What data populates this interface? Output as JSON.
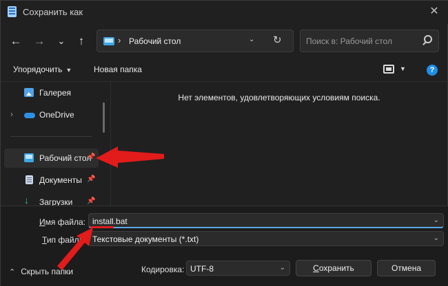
{
  "window": {
    "title": "Сохранить как",
    "close_glyph": "✕"
  },
  "nav": {
    "back": "←",
    "forward": "→",
    "recent": "⌄",
    "up": "↑",
    "address_chevron": "›",
    "address_path": "Рабочий стол",
    "address_dropdown": "⌄",
    "refresh": "↻",
    "search_placeholder": "Поиск в: Рабочий стол"
  },
  "toolbar": {
    "organize_label": "Упорядочить",
    "new_folder_label": "Новая папка",
    "help_label": "?"
  },
  "sidebar": {
    "items": [
      {
        "label": "Галерея",
        "icon": "gallery-icon"
      },
      {
        "label": "OneDrive",
        "icon": "cloud-icon",
        "expander": "›"
      },
      {
        "label": "Рабочий стол",
        "icon": "desktop-folder-icon",
        "pin": "📌",
        "selected": true
      },
      {
        "label": "Документы",
        "icon": "documents-icon",
        "pin": "📌"
      },
      {
        "label": "Загрузки",
        "icon": "downloads-icon",
        "pin": "📌"
      }
    ]
  },
  "main": {
    "empty_message": "Нет элементов, удовлетворяющих условиям поиска."
  },
  "bottom": {
    "filename_label_u": "И",
    "filename_label_rest": "мя файла:",
    "filename_value": "install.bat",
    "filetype_label_u": "Т",
    "filetype_label_rest": "ип файла:",
    "filetype_value": "Текстовые документы (*.txt)",
    "encoding_label": "Кодировка:",
    "encoding_value": "UTF-8",
    "hide_folders_label": "Скрыть папки",
    "save_label_u": "С",
    "save_label_rest": "охранить",
    "cancel_label": "Отмена"
  },
  "colors": {
    "annotation_arrow": "#e21b1b",
    "accent": "#1e8fe8"
  }
}
